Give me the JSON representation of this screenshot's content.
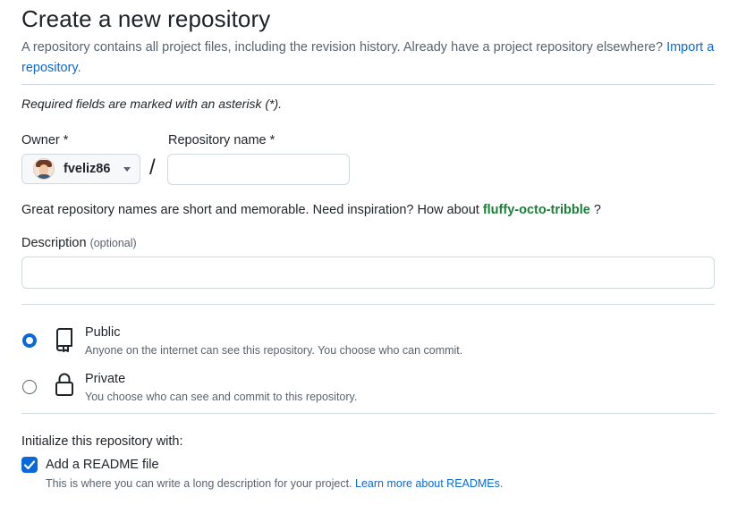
{
  "header": {
    "title": "Create a new repository",
    "subtitle_text": "A repository contains all project files, including the revision history. Already have a project repository elsewhere?",
    "import_link": "Import a repository",
    "import_suffix": "."
  },
  "required_note": "Required fields are marked with an asterisk (*).",
  "owner": {
    "label": "Owner *",
    "value": "fveliz86"
  },
  "slash": "/",
  "repo_name": {
    "label": "Repository name *",
    "value": "",
    "placeholder": ""
  },
  "hint": {
    "text": "Great repository names are short and memorable. Need inspiration? How about",
    "suggestion": "fluffy-octo-tribble",
    "suffix": "?"
  },
  "description": {
    "label": "Description",
    "optional": "(optional)",
    "value": ""
  },
  "visibility": {
    "options": [
      {
        "title": "Public",
        "desc": "Anyone on the internet can see this repository. You choose who can commit.",
        "selected": true,
        "icon": "repo-icon"
      },
      {
        "title": "Private",
        "desc": "You choose who can see and commit to this repository.",
        "selected": false,
        "icon": "lock-icon"
      }
    ]
  },
  "initialize": {
    "heading": "Initialize this repository with:",
    "readme_label": "Add a README file",
    "readme_checked": true,
    "readme_desc": "This is where you can write a long description for your project.",
    "readme_link": "Learn more about READMEs",
    "readme_link_suffix": "."
  },
  "colors": {
    "accent": "#0969da",
    "success_green": "#1a7f37",
    "muted_text": "#59636e",
    "border": "#d1d9e0"
  }
}
